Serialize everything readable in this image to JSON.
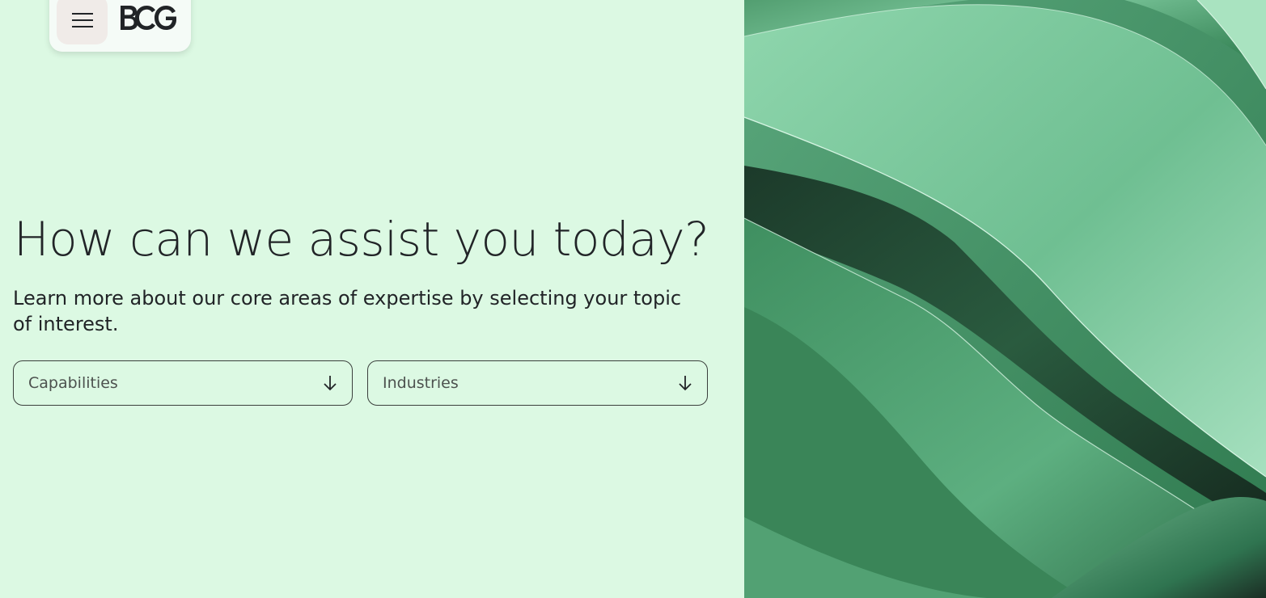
{
  "header": {
    "menu_icon": "hamburger-menu-icon",
    "logo_text": "BCG"
  },
  "hero": {
    "title": "How can we assist you today?",
    "subtitle": "Learn more about our core areas of expertise by selecting your topic of interest."
  },
  "filters": [
    {
      "label": "Capabilities",
      "icon": "arrow-down-icon"
    },
    {
      "label": "Industries",
      "icon": "arrow-down-icon"
    }
  ],
  "colors": {
    "background": "#dcf9e3",
    "text": "#212427",
    "menu_button": "#f0ebe8",
    "image_green": "#3f8f60"
  }
}
